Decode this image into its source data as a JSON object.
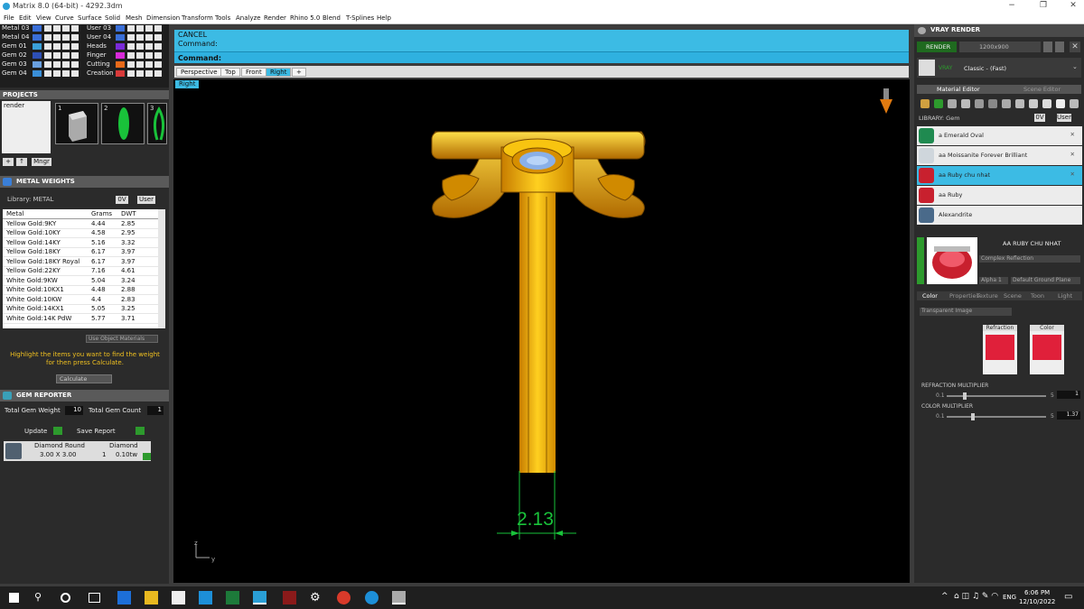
{
  "window": {
    "title": "Matrix 8.0 (64-bit) - 4292.3dm",
    "min": "−",
    "max": "❐",
    "close": "✕"
  },
  "menu": [
    "File",
    "Edit",
    "View",
    "Curve",
    "Surface",
    "Solid",
    "Mesh",
    "Dimension",
    "Transform",
    "Tools",
    "Analyze",
    "Render",
    "Rhino 5.0",
    "Blend",
    "T-Splines",
    "Help"
  ],
  "layers": {
    "left": [
      {
        "name": "Metal 03",
        "color": "#3a6fd8"
      },
      {
        "name": "Metal 04",
        "color": "#3a6fd8"
      },
      {
        "name": "Gem 01",
        "color": "#3aa0d8"
      },
      {
        "name": "Gem 02",
        "color": "#2d4fb5"
      },
      {
        "name": "Gem 03",
        "color": "#6aa0e0"
      },
      {
        "name": "Gem 04",
        "color": "#3a8fd8"
      }
    ],
    "right": [
      {
        "name": "User 03",
        "color": "#3a6fd8"
      },
      {
        "name": "User 04",
        "color": "#3a6fd8"
      },
      {
        "name": "Heads",
        "color": "#7a2ad8"
      },
      {
        "name": "Finger",
        "color": "#d82ad8"
      },
      {
        "name": "Cutting",
        "color": "#e86a1a"
      },
      {
        "name": "Creation",
        "color": "#d83a3a"
      }
    ]
  },
  "projects": {
    "title": "PROJECTS",
    "item": "render",
    "thumbs": [
      "1",
      "2",
      "3"
    ],
    "buttons": [
      "+",
      "↑",
      "Mngr"
    ]
  },
  "metal_weights": {
    "title": "METAL WEIGHTS",
    "library_label": "Library: METAL",
    "tag_0v": "0V",
    "tag_user": "User",
    "columns": [
      "Metal",
      "Grams",
      "DWT"
    ],
    "rows": [
      [
        "Yellow Gold:9KY",
        "4.44",
        "2.85"
      ],
      [
        "Yellow Gold:10KY",
        "4.58",
        "2.95"
      ],
      [
        "Yellow Gold:14KY",
        "5.16",
        "3.32"
      ],
      [
        "Yellow Gold:18KY",
        "6.17",
        "3.97"
      ],
      [
        "Yellow Gold:18KY Royal",
        "6.17",
        "3.97"
      ],
      [
        "Yellow Gold:22KY",
        "7.16",
        "4.61"
      ],
      [
        "White Gold:9KW",
        "5.04",
        "3.24"
      ],
      [
        "White Gold:10KX1",
        "4.48",
        "2.88"
      ],
      [
        "White Gold:10KW",
        "4.4",
        "2.83"
      ],
      [
        "White Gold:14KX1",
        "5.05",
        "3.25"
      ],
      [
        "White Gold:14K PdW",
        "5.77",
        "3.71"
      ]
    ],
    "use_object_materials": "Use Object Materials",
    "hint": "Highlight the items you want to find the weight for then press Calculate.",
    "calculate": "Calculate"
  },
  "gem_reporter": {
    "title": "GEM REPORTER",
    "total_weight_label": "Total Gem Weight",
    "total_weight": "10",
    "total_count_label": "Total Gem Count",
    "total_count": "1",
    "update": "Update",
    "save_report": "Save Report",
    "gem": {
      "shape": "Diamond Round",
      "type": "Diamond",
      "size": "3.00 X 3.00",
      "count": "1",
      "weight": "0.10tw"
    }
  },
  "command": {
    "line1": "CANCEL",
    "line2": "Command:",
    "prompt": "Command:"
  },
  "viewport": {
    "tabs": [
      "Perspective",
      "Top",
      "Front",
      "Right"
    ],
    "active_tab": "Right",
    "view_label": "Right",
    "dimension": "2.13",
    "axis_z": "z",
    "axis_y": "y"
  },
  "vray": {
    "title": "VRAY RENDER",
    "render_btn": "RENDER",
    "resolution": "1200x900",
    "preset_label": "VRAY",
    "preset": "Classic - (Fast)",
    "tabs": [
      "Material Editor",
      "Scene Editor"
    ],
    "library_label": "LIBRARY: Gem",
    "materials": [
      {
        "name": "a Emerald Oval",
        "color": "#1f8a50"
      },
      {
        "name": "aa Moissanite Forever Brilliant",
        "color": "#cfd6dc"
      },
      {
        "name": "aa Ruby chu nhat",
        "color": "#c8202e",
        "selected": true
      },
      {
        "name": "aa Ruby",
        "color": "#c8202e"
      },
      {
        "name": "Alexandrite",
        "color": "#4a6a8a"
      }
    ],
    "selected_name": "AA RUBY CHU NHAT",
    "reflection": "Complex Reflection",
    "alpha_label": "Alpha",
    "alpha_val": "1",
    "ground": "Default Ground Plane",
    "subtabs": [
      "Color",
      "Properties",
      "Texture",
      "Scene",
      "Toon",
      "Light"
    ],
    "mode": "Transparent Image",
    "swatch_refraction": "Refraction",
    "swatch_color": "Color",
    "refr_mult_label": "REFRACTION MULTIPLIER",
    "refr_min": "0.1",
    "refr_max": "5",
    "refr_val": "1",
    "color_mult_label": "COLOR MULTIPLIER",
    "color_min": "0.1",
    "color_max": "5",
    "color_val": "1.37"
  },
  "taskbar": {
    "time": "6:06 PM",
    "date": "12/10/2022",
    "lang": "ENG"
  }
}
